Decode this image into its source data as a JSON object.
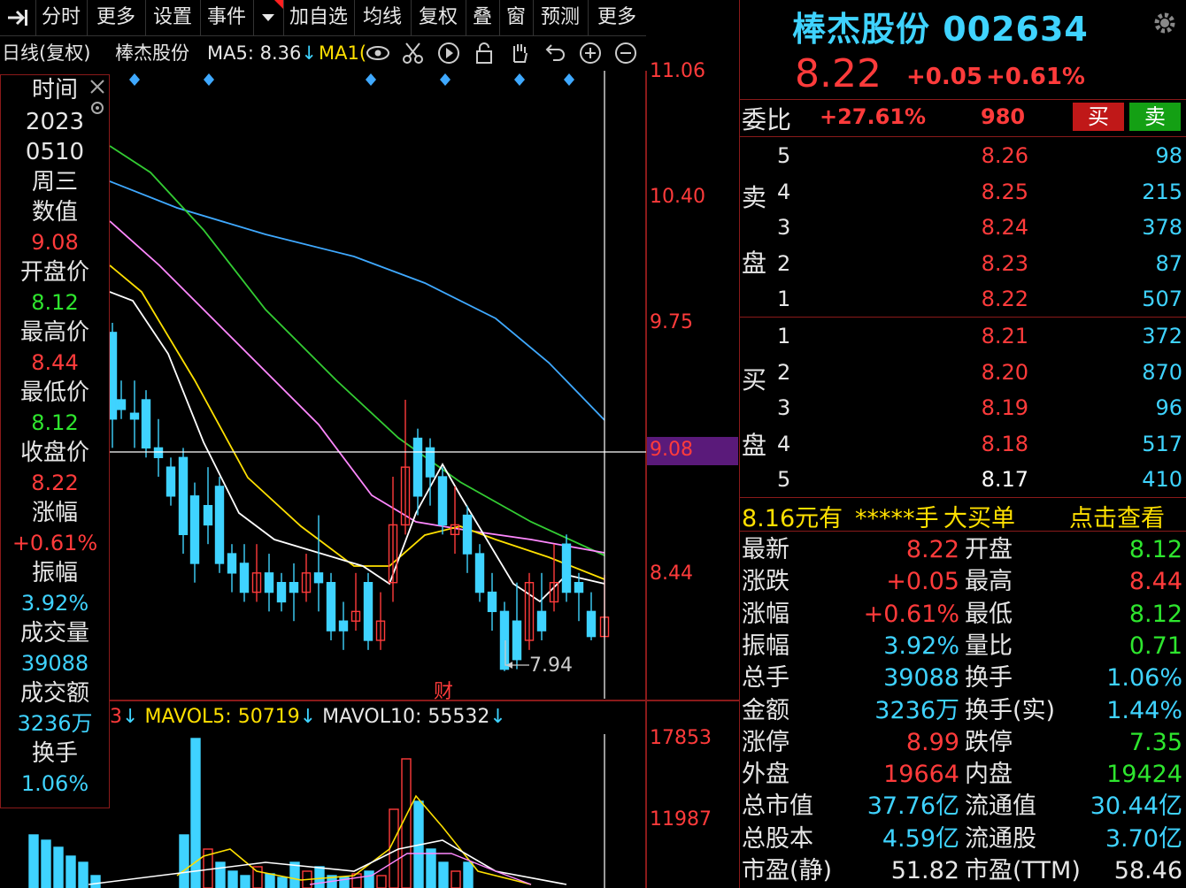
{
  "toolbar": {
    "items": [
      "分时",
      "更多",
      "设置",
      "事件",
      "加自选",
      "均线",
      "复权",
      "叠",
      "窗",
      "预测",
      "更多"
    ]
  },
  "chart_header": {
    "period": "日线(复权)",
    "stock": "棒杰股份",
    "ma5_label": "MA5: 8.36",
    "ma10_label": "MA1("
  },
  "info_panel": {
    "time_label": "时间",
    "year": "2023",
    "date": "0510",
    "weekday": "周三",
    "value_label": "数值",
    "value": "9.08",
    "open_label": "开盘价",
    "open": "8.12",
    "high_label": "最高价",
    "high": "8.44",
    "low_label": "最低价",
    "low": "8.12",
    "close_label": "收盘价",
    "close": "8.22",
    "change_label": "涨幅",
    "change": "+0.61%",
    "amplitude_label": "振幅",
    "amplitude": "3.92%",
    "volume_label": "成交量",
    "volume": "39088",
    "amount_label": "成交额",
    "amount": "3236万",
    "turnover_label": "换手",
    "turnover": "1.06%"
  },
  "price_axis": [
    "11.06",
    "10.40",
    "9.75",
    "9.08",
    "8.44"
  ],
  "volume_axis": [
    "17853",
    "11987"
  ],
  "crosshair_value": "9.08",
  "low_marker": "7.94",
  "event_marker": "财",
  "volume_header": {
    "mavol5": "MAVOL5: 50719",
    "mavol10": "MAVOL10: 55532",
    "prefix": "3"
  },
  "quote": {
    "name_code": "棒杰股份 002634",
    "price": "8.22",
    "change": "+0.05",
    "change_pct": "+0.61%",
    "weibi_label": "委比",
    "weibi": "+27.61%",
    "weicha": "980",
    "buy_btn": "买",
    "sell_btn": "卖"
  },
  "orderbook": {
    "sell_label_1": "卖",
    "sell_label_2": "盘",
    "buy_label_1": "买",
    "buy_label_2": "盘",
    "asks": [
      {
        "level": "5",
        "price": "8.26",
        "vol": "98"
      },
      {
        "level": "4",
        "price": "8.25",
        "vol": "215"
      },
      {
        "level": "3",
        "price": "8.24",
        "vol": "378"
      },
      {
        "level": "2",
        "price": "8.23",
        "vol": "87"
      },
      {
        "level": "1",
        "price": "8.22",
        "vol": "507"
      }
    ],
    "bids": [
      {
        "level": "1",
        "price": "8.21",
        "vol": "372"
      },
      {
        "level": "2",
        "price": "8.20",
        "vol": "870"
      },
      {
        "level": "3",
        "price": "8.19",
        "vol": "96"
      },
      {
        "level": "4",
        "price": "8.18",
        "vol": "517"
      },
      {
        "level": "5",
        "price": "8.17",
        "vol": "410"
      }
    ]
  },
  "big_order": {
    "price_text": "8.16元有",
    "stars": "*****手",
    "label": "大买单",
    "link": "点击查看"
  },
  "stats": [
    {
      "l1": "最新",
      "v1": "8.22",
      "c1": "r",
      "l2": "开盘",
      "v2": "8.12",
      "c2": "g"
    },
    {
      "l1": "涨跌",
      "v1": "+0.05",
      "c1": "r",
      "l2": "最高",
      "v2": "8.44",
      "c2": "r"
    },
    {
      "l1": "涨幅",
      "v1": "+0.61%",
      "c1": "r",
      "l2": "最低",
      "v2": "8.12",
      "c2": "g"
    },
    {
      "l1": "振幅",
      "v1": "3.92%",
      "c1": "c",
      "l2": "量比",
      "v2": "0.71",
      "c2": "g"
    },
    {
      "l1": "总手",
      "v1": "39088",
      "c1": "c",
      "l2": "换手",
      "v2": "1.06%",
      "c2": "c"
    },
    {
      "l1": "金额",
      "v1": "3236万",
      "c1": "c",
      "l2": "换手(实)",
      "v2": "1.44%",
      "c2": "c"
    },
    {
      "l1": "涨停",
      "v1": "8.99",
      "c1": "r",
      "l2": "跌停",
      "v2": "7.35",
      "c2": "g"
    },
    {
      "l1": "外盘",
      "v1": "19664",
      "c1": "r",
      "l2": "内盘",
      "v2": "19424",
      "c2": "g"
    },
    {
      "l1": "总市值",
      "v1": "37.76亿",
      "c1": "c",
      "l2": "流通值",
      "v2": "30.44亿",
      "c2": "c"
    },
    {
      "l1": "总股本",
      "v1": "4.59亿",
      "c1": "c",
      "l2": "流通股",
      "v2": "3.70亿",
      "c2": "c"
    },
    {
      "l1": "市盈(静)",
      "v1": "51.82",
      "c1": "w",
      "l2": "市盈(TTM)",
      "v2": "58.46",
      "c2": "w"
    }
  ],
  "colors": {
    "up": "#ff3b3b",
    "down": "#3fd3ff",
    "ma5": "#ffffff",
    "ma10": "#ffe000",
    "ma20": "#ff88ff",
    "ma60": "#33cc33",
    "ma120": "#3fa9ff"
  }
}
